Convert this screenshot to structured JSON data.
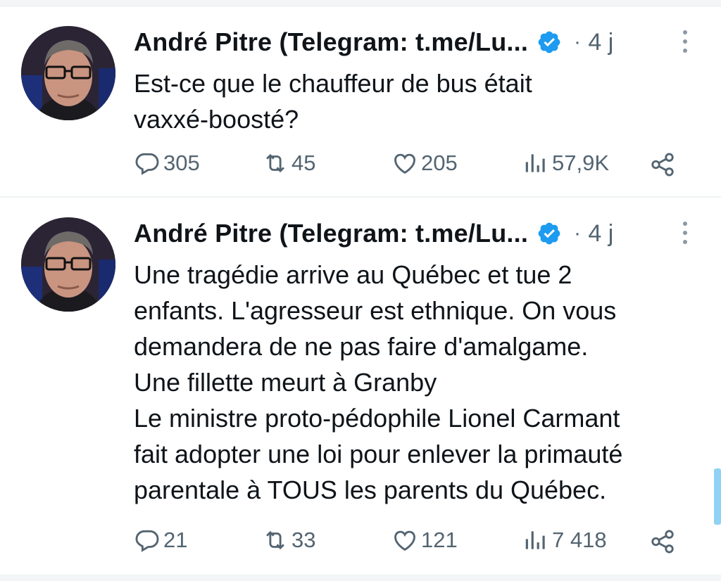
{
  "tweets": [
    {
      "author": "André Pitre (Telegram: t.me/Lu...",
      "separator": "·",
      "time": "4 j",
      "text": "Est-ce que le chauffeur de bus était\nvaxxé-boosté?",
      "replies": "305",
      "retweets": "45",
      "likes": "205",
      "views": "57,9K"
    },
    {
      "author": "André Pitre (Telegram: t.me/Lu...",
      "separator": "·",
      "time": "4 j",
      "text": "Une tragédie arrive au Québec et tue 2\nenfants.  L'agresseur est ethnique.  On vous\ndemandera de ne pas faire d'amalgame.\nUne fillette meurt à Granby\nLe ministre proto-pédophile Lionel Carmant\nfait adopter une loi pour enlever la primauté\nparentale à TOUS les parents du Québec.",
      "replies": "21",
      "retweets": "33",
      "likes": "121",
      "views": "7 418"
    }
  ],
  "icons": {
    "reply": "reply-icon",
    "retweet": "retweet-icon",
    "like": "heart-icon",
    "views": "views-chart-icon",
    "share": "share-icon",
    "verified": "verified-badge-icon",
    "more": "more-vertical-icon"
  },
  "colors": {
    "verified_blue": "#1d9bf0",
    "secondary_text": "#536471",
    "scrollbar": "#8fd2f5"
  }
}
